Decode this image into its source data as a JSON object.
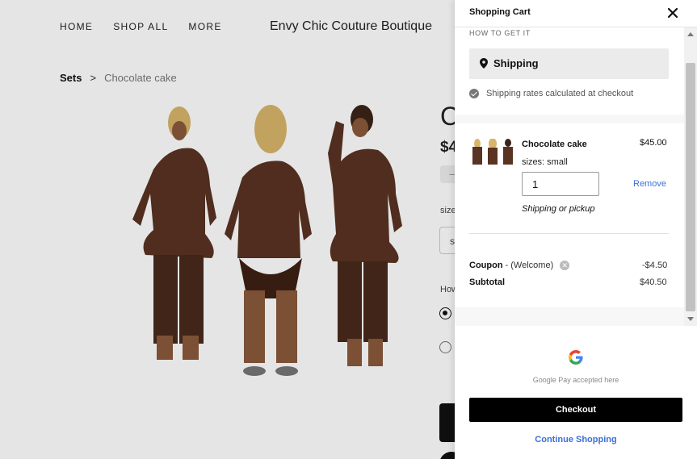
{
  "nav": {
    "items": [
      {
        "label": "HOME"
      },
      {
        "label": "SHOP ALL"
      },
      {
        "label": "MORE"
      }
    ],
    "brand": "Envy Chic Couture Boutique"
  },
  "breadcrumb": {
    "category": "Sets",
    "separator": ">",
    "current": "Chocolate cake"
  },
  "product": {
    "title_partial": "C",
    "price_partial": "$4",
    "qty_minus": "−",
    "size_label_partial": "size",
    "size_value_partial": "s",
    "how_label_partial": "How"
  },
  "cart": {
    "title": "Shopping Cart",
    "how_label": "HOW TO GET IT",
    "shipping_option": "Shipping",
    "rates_note": "Shipping rates calculated at checkout",
    "item": {
      "name": "Chocolate cake",
      "price": "$45.00",
      "variant": "sizes: small",
      "quantity": "1",
      "remove_label": "Remove",
      "fulfillment": "Shipping or pickup"
    },
    "coupon_label": "Coupon",
    "coupon_code": " - (Welcome)",
    "coupon_amount": "-$4.50",
    "subtotal_label": "Subtotal",
    "subtotal_value": "$40.50",
    "gpay_note": "Google Pay accepted here",
    "checkout_label": "Checkout",
    "continue_label": "Continue Shopping"
  },
  "colors": {
    "accent_link": "#3a6fd8",
    "checkout_bg": "#000000",
    "product_brown": "#5a3322"
  }
}
